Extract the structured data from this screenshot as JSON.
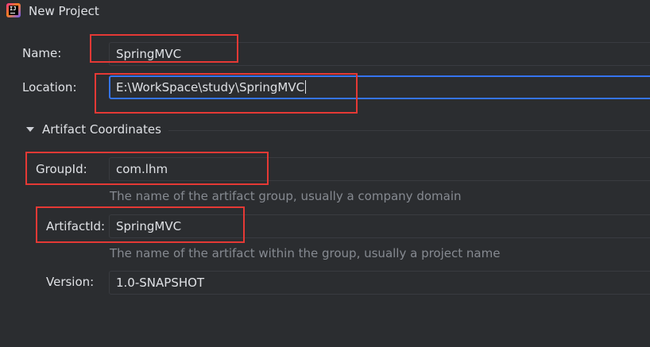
{
  "window": {
    "title": "New Project",
    "app_icon": "intellij-idea-icon"
  },
  "form": {
    "name": {
      "label": "Name:",
      "value": "SpringMVC"
    },
    "location": {
      "label": "Location:",
      "value": "E:\\WorkSpace\\study\\SpringMVC"
    },
    "artifact_coordinates": {
      "section_label": "Artifact Coordinates",
      "expanded": true,
      "group_id": {
        "label": "GroupId:",
        "value": "com.lhm",
        "hint": "The name of the artifact group, usually a company domain"
      },
      "artifact_id": {
        "label": "ArtifactId:",
        "value": "SpringMVC",
        "hint": "The name of the artifact within the group, usually a project name"
      },
      "version": {
        "label": "Version:",
        "value": "1.0-SNAPSHOT"
      }
    }
  },
  "colors": {
    "background": "#2b2d30",
    "focus": "#3574f0",
    "annotation": "#e53935",
    "hint": "#868a91"
  }
}
